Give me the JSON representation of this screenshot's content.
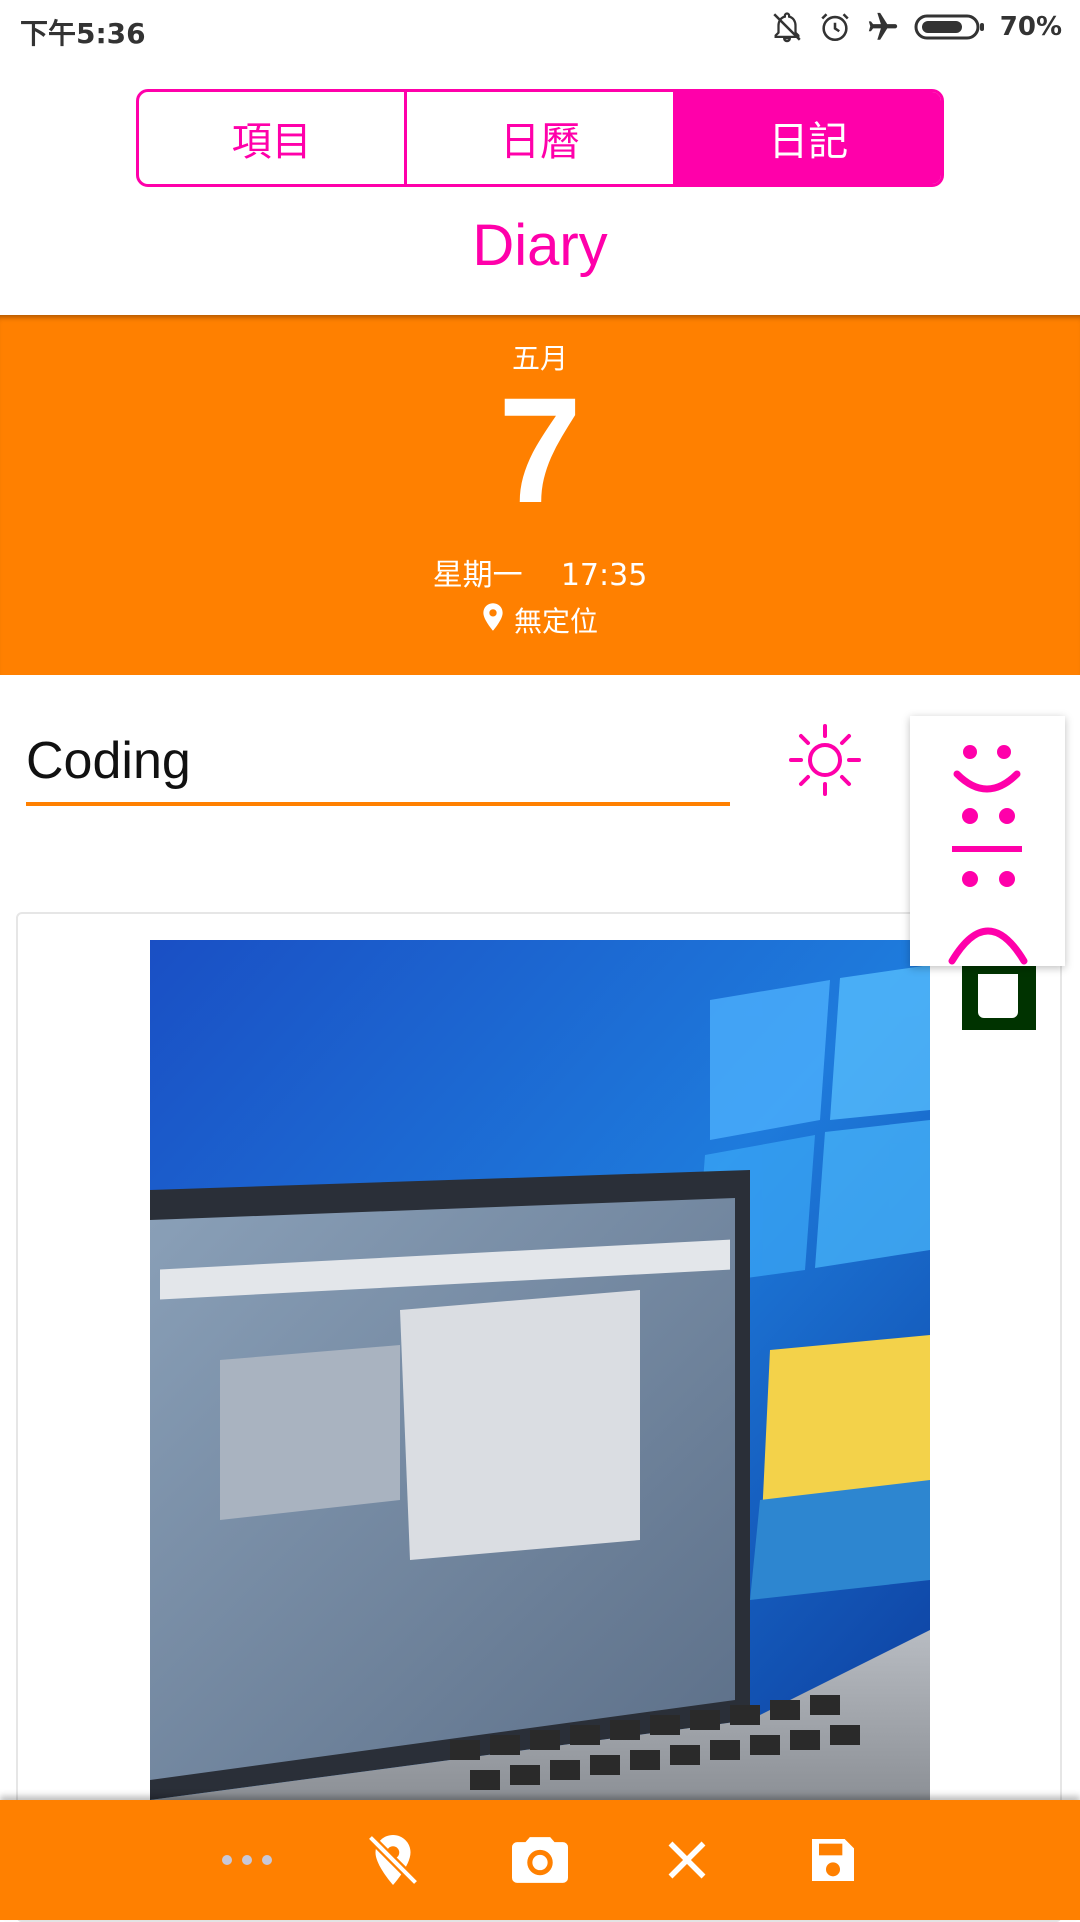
{
  "status_bar": {
    "time": "下午5:36",
    "battery": "70%",
    "icons": [
      "notifications-off-icon",
      "alarm-icon",
      "airplane-mode-icon",
      "battery-icon"
    ]
  },
  "tabs": [
    {
      "label": "項目",
      "active": false
    },
    {
      "label": "日曆",
      "active": false
    },
    {
      "label": "日記",
      "active": true
    }
  ],
  "page_title": "Diary",
  "date": {
    "month": "五月",
    "day": "7",
    "weekday": "星期一",
    "time": "17:35",
    "location": "無定位"
  },
  "entry": {
    "title": "Coding",
    "weather_icon": "sun-icon"
  },
  "mood_options": [
    "happy-face-icon",
    "neutral-face-icon",
    "sad-face-icon"
  ],
  "toolbar": {
    "buttons": [
      "more-icon",
      "location-off-icon",
      "camera-icon",
      "close-icon",
      "save-icon"
    ]
  },
  "colors": {
    "accent": "#ff00aa",
    "primary": "#ff8000",
    "delete_button": "#003300"
  }
}
